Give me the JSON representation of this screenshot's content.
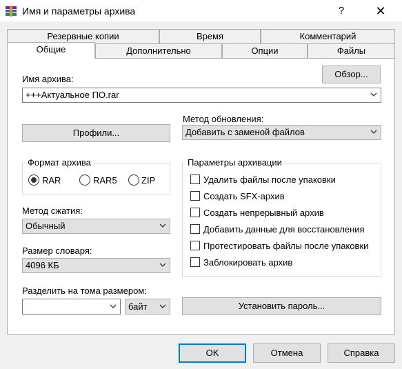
{
  "window": {
    "title": "Имя и параметры архива",
    "help_label": "?",
    "close_label": "✕"
  },
  "tabs": {
    "row1": [
      "Резервные копии",
      "Время",
      "Комментарий"
    ],
    "row2": [
      "Общие",
      "Дополнительно",
      "Опции",
      "Файлы"
    ],
    "active": "Общие"
  },
  "general": {
    "archive_name_label": "Имя архива:",
    "browse_label": "Обзор...",
    "archive_name_value": "+++Актуальное ПО.rar",
    "update_method_label": "Метод обновления:",
    "update_method_value": "Добавить с заменой файлов",
    "profiles_label": "Профили...",
    "format_group_label": "Формат архива",
    "format_options": [
      "RAR",
      "RAR5",
      "ZIP"
    ],
    "format_selected": "RAR",
    "compression_label": "Метод сжатия:",
    "compression_value": "Обычный",
    "dictionary_label": "Размер словаря:",
    "dictionary_value": "4096 КБ",
    "split_label": "Разделить на тома размером:",
    "split_value": "",
    "split_unit_value": "байт",
    "password_label": "Установить пароль...",
    "options_group_label": "Параметры архивации",
    "options": [
      {
        "label": "Удалить файлы после упаковки",
        "checked": false
      },
      {
        "label": "Создать SFX-архив",
        "checked": false
      },
      {
        "label": "Создать непрерывный архив",
        "checked": false
      },
      {
        "label": "Добавить данные для восстановления",
        "checked": false
      },
      {
        "label": "Протестировать файлы после упаковки",
        "checked": false
      },
      {
        "label": "Заблокировать архив",
        "checked": false
      }
    ]
  },
  "footer": {
    "ok_label": "OK",
    "cancel_label": "Отмена",
    "help_label": "Справка"
  },
  "colors": {
    "accent": "#0078d7"
  }
}
